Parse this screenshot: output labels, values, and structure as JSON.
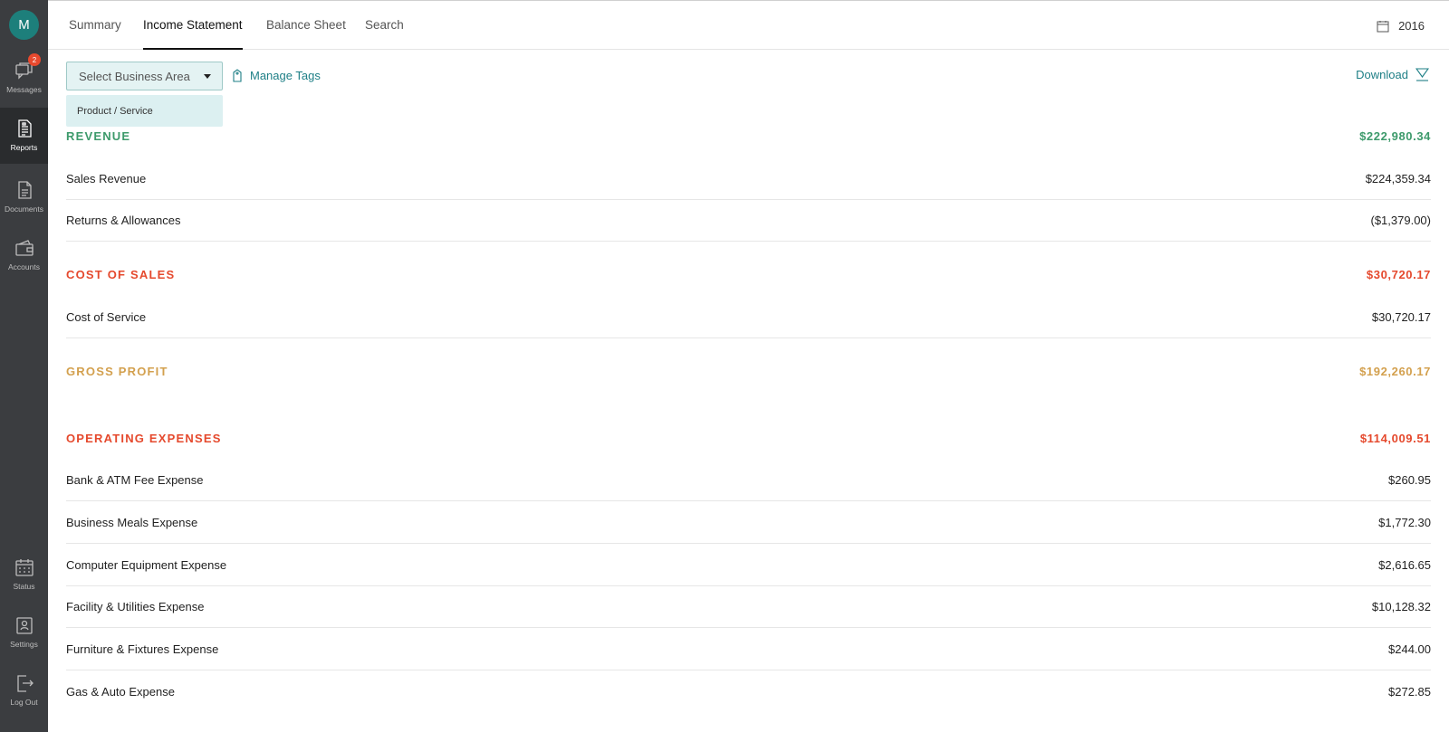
{
  "sidebar": {
    "avatar_letter": "M",
    "messages_badge": "2",
    "items": [
      {
        "label": "Messages",
        "icon": "messages-icon"
      },
      {
        "label": "Reports",
        "icon": "reports-icon",
        "active": true
      },
      {
        "label": "Documents",
        "icon": "documents-icon"
      },
      {
        "label": "Accounts",
        "icon": "accounts-icon"
      },
      {
        "label": "Status",
        "icon": "status-icon"
      },
      {
        "label": "Settings",
        "icon": "settings-icon"
      },
      {
        "label": "Log Out",
        "icon": "logout-icon"
      }
    ]
  },
  "tabs": [
    {
      "label": "Summary"
    },
    {
      "label": "Income Statement",
      "active": true
    },
    {
      "label": "Balance Sheet"
    },
    {
      "label": "Search"
    }
  ],
  "year": "2016",
  "toolbar": {
    "select_placeholder": "Select Business Area",
    "dropdown_option": "Product / Service",
    "manage_tags": "Manage Tags",
    "download": "Download"
  },
  "colors": {
    "accent": "#1e7f86",
    "revenue": "#3d9a6b",
    "expense": "#e5492d",
    "profit": "#d3a04e",
    "sidebar": "#3b3d40"
  },
  "report": {
    "revenue": {
      "title": "REVENUE",
      "total": "$222,980.34",
      "rows": [
        {
          "name": "Sales Revenue",
          "amount": "$224,359.34"
        },
        {
          "name": "Returns & Allowances",
          "amount": "($1,379.00)"
        }
      ]
    },
    "cost_of_sales": {
      "title": "COST OF SALES",
      "total": "$30,720.17",
      "rows": [
        {
          "name": "Cost of Service",
          "amount": "$30,720.17"
        }
      ]
    },
    "gross_profit": {
      "title": "GROSS PROFIT",
      "total": "$192,260.17"
    },
    "operating_expenses": {
      "title": "OPERATING EXPENSES",
      "total": "$114,009.51",
      "rows": [
        {
          "name": "Bank & ATM Fee Expense",
          "amount": "$260.95"
        },
        {
          "name": "Business Meals Expense",
          "amount": "$1,772.30"
        },
        {
          "name": "Computer Equipment Expense",
          "amount": "$2,616.65"
        },
        {
          "name": "Facility & Utilities Expense",
          "amount": "$10,128.32"
        },
        {
          "name": "Furniture & Fixtures Expense",
          "amount": "$244.00"
        },
        {
          "name": "Gas & Auto Expense",
          "amount": "$272.85"
        }
      ]
    }
  }
}
